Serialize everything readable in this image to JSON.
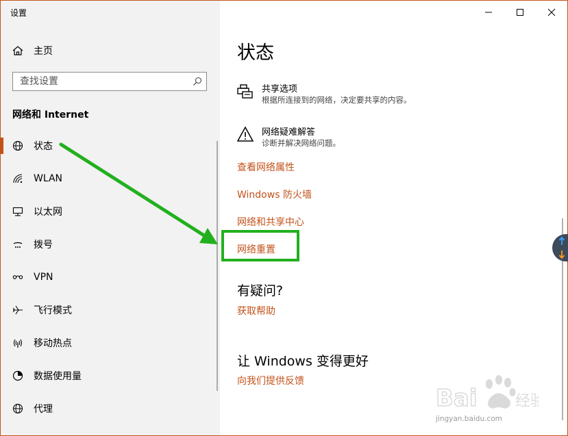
{
  "app": {
    "title": "设置"
  },
  "sidebar": {
    "home_label": "主页",
    "search": {
      "placeholder": "查找设置"
    },
    "section_title": "网络和 Internet",
    "items": [
      {
        "label": "状态",
        "icon": "globe-icon",
        "selected": true
      },
      {
        "label": "WLAN",
        "icon": "wifi-icon",
        "selected": false
      },
      {
        "label": "以太网",
        "icon": "ethernet-icon",
        "selected": false
      },
      {
        "label": "拨号",
        "icon": "dialup-icon",
        "selected": false
      },
      {
        "label": "VPN",
        "icon": "vpn-icon",
        "selected": false
      },
      {
        "label": "飞行模式",
        "icon": "airplane-icon",
        "selected": false
      },
      {
        "label": "移动热点",
        "icon": "hotspot-icon",
        "selected": false
      },
      {
        "label": "数据使用量",
        "icon": "data-usage-icon",
        "selected": false
      },
      {
        "label": "代理",
        "icon": "proxy-icon",
        "selected": false
      }
    ]
  },
  "main": {
    "title": "状态",
    "options": [
      {
        "title": "共享选项",
        "desc": "根据所连接到的网络，决定要共享的内容。",
        "icon": "sharing-printer-icon"
      },
      {
        "title": "网络疑难解答",
        "desc": "诊断并解决网络问题。",
        "icon": "warning-icon"
      }
    ],
    "links": [
      "查看网络属性",
      "Windows 防火墙",
      "网络和共享中心",
      "网络重置"
    ],
    "help": {
      "title": "有疑问?",
      "link": "获取帮助"
    },
    "feedback": {
      "title": "让 Windows 变得更好",
      "link": "向我们提供反馈"
    }
  },
  "colors": {
    "accent": "#c3521a",
    "annotation": "#22b01e",
    "sidebar_bg": "#f2f2f2"
  },
  "watermark": {
    "logo": "Baidu经验",
    "url": "jingyan.baidu.com"
  }
}
